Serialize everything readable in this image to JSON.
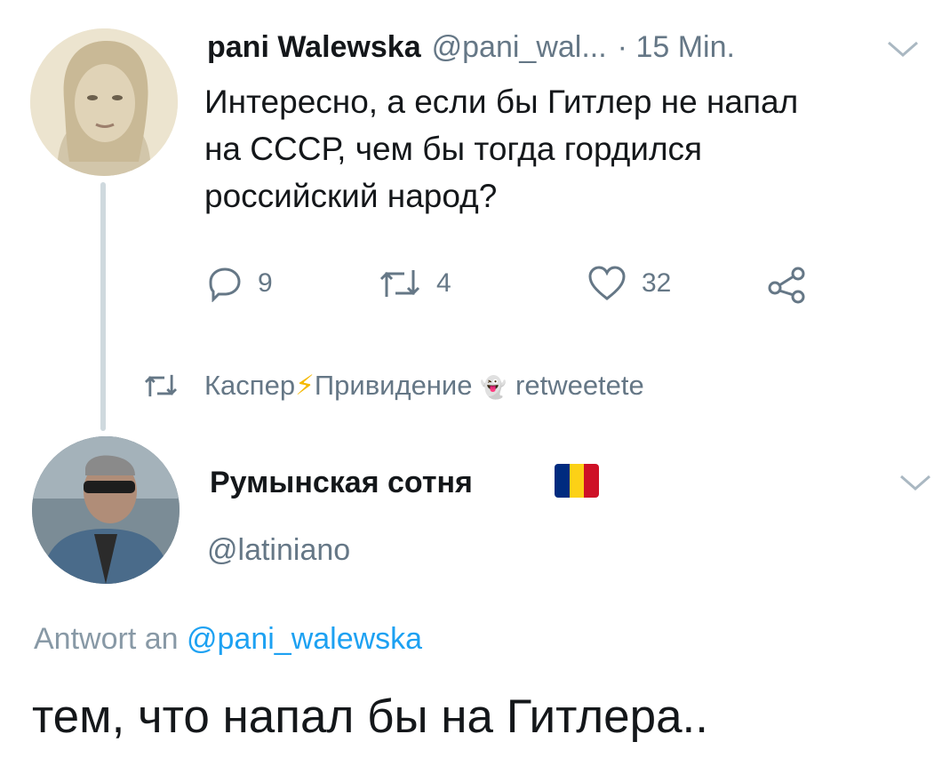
{
  "tweet1": {
    "author_name": "pani Walewska",
    "handle": "@pani_wal...",
    "time": "· 15 Min.",
    "text_lines": [
      "Интересно, а если бы Гитлер не напал",
      "на СССР, чем бы тогда гордился",
      "российский народ?"
    ],
    "actions": {
      "reply_count": "9",
      "retweet_count": "4",
      "like_count": "32"
    }
  },
  "retweet_notice": {
    "name_part1": "Каспер",
    "bolt_emoji": "⚡",
    "name_part2": "Привидение",
    "ghost_emoji": "👻",
    "action_text": "retweetete"
  },
  "tweet2": {
    "author_name": "Румынская сотня",
    "handle": "@latiniano",
    "reply_prefix": "Antwort an",
    "reply_mention": "@pani_walewska",
    "text": "тем, что напал бы на Гитлера.."
  },
  "colors": {
    "text": "#14171a",
    "secondary": "#657786",
    "link": "#1da1f2",
    "line": "#cfd9de",
    "flag_blue": "#002b7f",
    "flag_yellow": "#fcd116",
    "flag_red": "#ce1126"
  },
  "icons": [
    "reply-icon",
    "retweet-icon",
    "like-icon",
    "share-icon",
    "chevron-down-icon"
  ]
}
